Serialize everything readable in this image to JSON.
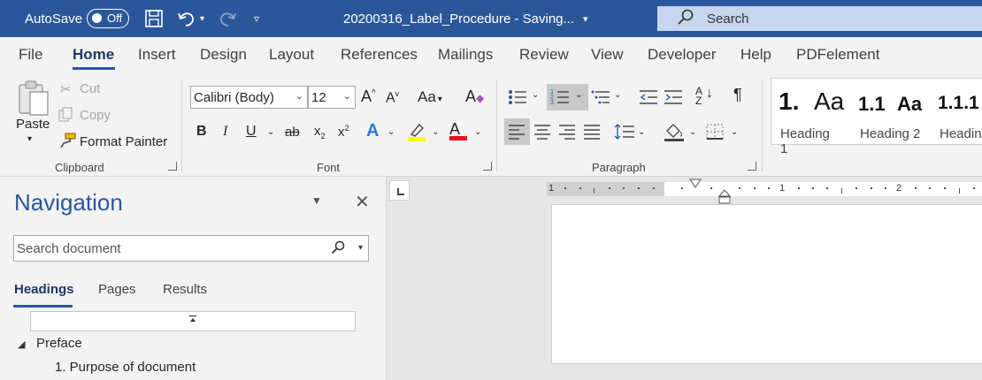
{
  "titlebar": {
    "autosave_label": "AutoSave",
    "autosave_state": "Off",
    "document_title": "20200316_Label_Procedure  -  Saving...",
    "search_label": "Search",
    "colors": {
      "bar": "#2b579a",
      "search_bg": "#c7d6ee"
    }
  },
  "menu": {
    "tabs": [
      {
        "label": "File"
      },
      {
        "label": "Home",
        "active": true
      },
      {
        "label": "Insert"
      },
      {
        "label": "Design"
      },
      {
        "label": "Layout"
      },
      {
        "label": "References"
      },
      {
        "label": "Mailings"
      },
      {
        "label": "Review"
      },
      {
        "label": "View"
      },
      {
        "label": "Developer"
      },
      {
        "label": "Help"
      },
      {
        "label": "PDFelement"
      }
    ]
  },
  "ribbon": {
    "clipboard": {
      "paste": "Paste",
      "cut": "Cut",
      "copy": "Copy",
      "format_painter": "Format Painter",
      "group_label": "Clipboard"
    },
    "font": {
      "font_name": "Calibri (Body)",
      "font_size": "12",
      "case_label": "Aa",
      "bold": "B",
      "italic": "I",
      "underline": "U",
      "strike": "ab",
      "subscript": "x",
      "superscript": "x",
      "group_label": "Font",
      "highlight_color": "#ffff00",
      "font_color": "#e81123"
    },
    "paragraph": {
      "group_label": "Paragraph",
      "pilcrow": "¶"
    },
    "styles": {
      "items": [
        {
          "sample": "1.",
          "sample2": "Aa",
          "name": "Heading 1"
        },
        {
          "sample": "1.1",
          "sample2": "Aa",
          "name": "Heading 2"
        },
        {
          "sample": "1.1.1",
          "name": "Headin"
        }
      ]
    }
  },
  "navigation": {
    "title": "Navigation",
    "search_placeholder": "Search document",
    "tabs": [
      {
        "label": "Headings",
        "active": true
      },
      {
        "label": "Pages"
      },
      {
        "label": "Results"
      }
    ],
    "tree": [
      {
        "label": "Preface"
      },
      {
        "label": "1. Purpose of document"
      }
    ]
  },
  "ruler": {
    "numbers": [
      "1",
      "1",
      "2"
    ]
  }
}
